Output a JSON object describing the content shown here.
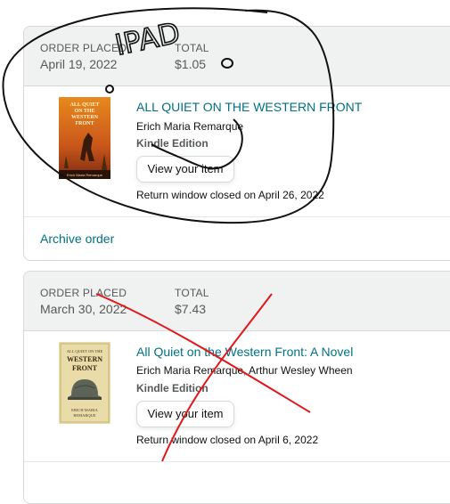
{
  "orders": [
    {
      "placed_label": "ORDER PLACED",
      "placed_date": "April 19, 2022",
      "total_label": "TOTAL",
      "total_value": "$1.05",
      "item": {
        "title": "ALL QUIET ON THE WESTERN FRONT",
        "author": "Erich Maria Remarque",
        "format": "Kindle Edition",
        "view_button": "View your item",
        "return_window": "Return window closed on April 26, 2022",
        "cover_title": "ALL QUIET ON THE WESTERN FRONT",
        "cover_author": "Erich Maria Remarque"
      },
      "archive_link": "Archive order"
    },
    {
      "placed_label": "ORDER PLACED",
      "placed_date": "March 30, 2022",
      "total_label": "TOTAL",
      "total_value": "$7.43",
      "item": {
        "title": "All Quiet on the Western Front: A Novel",
        "author": "Erich Maria Remarque, Arthur Wesley Wheen",
        "format": "Kindle Edition",
        "view_button": "View your item",
        "return_window": "Return window closed on April 6, 2022",
        "cover_title_top": "ALL QUIET ON THE",
        "cover_title_main": "WESTERN FRONT",
        "cover_author": "ERICH MARIA REMARQUE"
      }
    }
  ],
  "annotation": {
    "handwriting": "IPAD",
    "circle_color": "#111111",
    "cross_color": "#e0171b"
  },
  "colors": {
    "link": "#007185",
    "header_bg": "#f0f2f2",
    "border": "#d5d9d9"
  }
}
